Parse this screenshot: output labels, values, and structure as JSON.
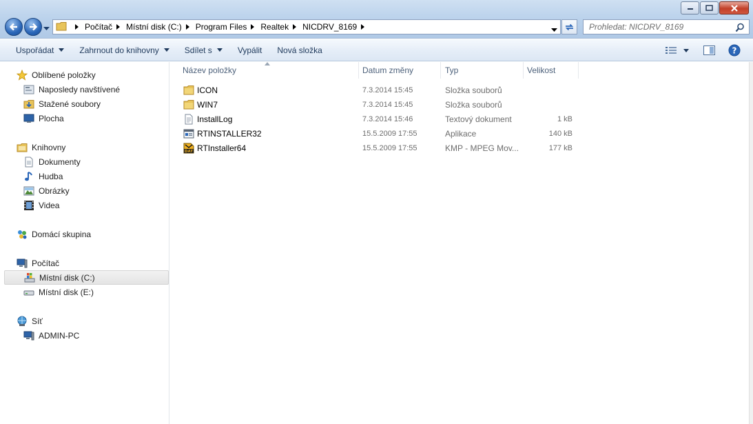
{
  "window": {
    "search_placeholder": "Prohledat: NICDRV_8169"
  },
  "breadcrumb": [
    "Počítač",
    "Místní disk (C:)",
    "Program Files",
    "Realtek",
    "NICDRV_8169"
  ],
  "toolbar": {
    "organize": "Uspořádat",
    "include_library": "Zahrnout do knihovny",
    "share": "Sdílet s",
    "burn": "Vypálit",
    "new_folder": "Nová složka"
  },
  "sidebar": {
    "favorites": {
      "label": "Oblíbené položky",
      "items": [
        "Naposledy navštívené",
        "Stažené soubory",
        "Plocha"
      ]
    },
    "libraries": {
      "label": "Knihovny",
      "items": [
        "Dokumenty",
        "Hudba",
        "Obrázky",
        "Videa"
      ]
    },
    "homegroup": {
      "label": "Domácí skupina"
    },
    "computer": {
      "label": "Počítač",
      "items": [
        "Místní disk (C:)",
        "Místní disk (E:)"
      ]
    },
    "network": {
      "label": "Síť",
      "items": [
        "ADMIN-PC"
      ]
    }
  },
  "columns": {
    "name": "Název položky",
    "date": "Datum změny",
    "type": "Typ",
    "size": "Velikost"
  },
  "files": [
    {
      "name": "ICON",
      "date": "7.3.2014 15:45",
      "type": "Složka souborů",
      "size": "",
      "icon": "folder-icon"
    },
    {
      "name": "WIN7",
      "date": "7.3.2014 15:45",
      "type": "Složka souborů",
      "size": "",
      "icon": "folder-icon"
    },
    {
      "name": "InstallLog",
      "date": "7.3.2014 15:46",
      "type": "Textový dokument",
      "size": "1 kB",
      "icon": "text-file-icon"
    },
    {
      "name": "RTINSTALLER32",
      "date": "15.5.2009 17:55",
      "type": "Aplikace",
      "size": "140 kB",
      "icon": "application-icon"
    },
    {
      "name": "RTInstaller64",
      "date": "15.5.2009 17:55",
      "type": "KMP - MPEG Mov...",
      "size": "177 kB",
      "icon": "dat-file-icon"
    }
  ],
  "colors": {
    "accent": "#1e395b",
    "selection": "#e4e4e4",
    "folder": "#e8c45a"
  }
}
